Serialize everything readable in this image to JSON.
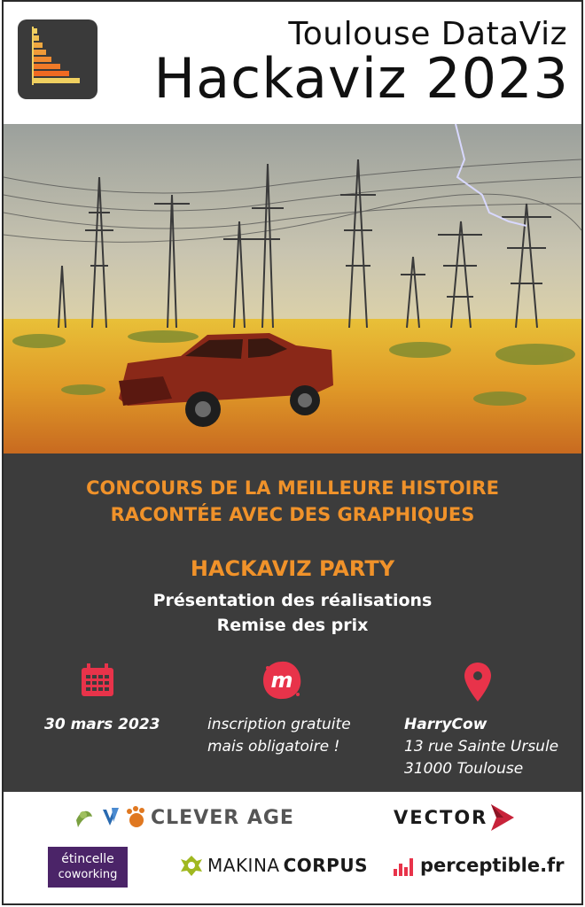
{
  "header": {
    "subtitle": "Toulouse DataViz",
    "title": "Hackaviz 2023"
  },
  "contest": {
    "line1": "CONCOURS DE LA MEILLEURE HISTOIRE",
    "line2": "RACONTÉE AVEC DES GRAPHIQUES"
  },
  "party": {
    "title": "HACKAVIZ PARTY",
    "line1": "Présentation des réalisations",
    "line2": "Remise des prix"
  },
  "event": {
    "date": "30 mars 2023",
    "registration_line1": "inscription gratuite",
    "registration_line2": "mais obligatoire !",
    "venue_name": "HarryCow",
    "venue_street": "13 rue Sainte Ursule",
    "venue_city": "31000 Toulouse"
  },
  "sponsors": {
    "clever_age": "CLEVER AGE",
    "vector": "VECTOR",
    "etincelle_line1": "étincelle",
    "etincelle_line2": "coworking",
    "makina_part1": "MAKINA",
    "makina_part2": "CORPUS",
    "perceptible": "perceptible.fr"
  },
  "colors": {
    "accent": "#f0922a",
    "panel": "#3c3c3c",
    "icon_red": "#e8334a",
    "etincelle": "#4b2468",
    "vector_red": "#c8233a"
  },
  "icons": {
    "logo": "bar-chart-logo-icon",
    "date": "calendar-icon",
    "registration": "meetup-icon",
    "venue": "map-pin-icon"
  }
}
